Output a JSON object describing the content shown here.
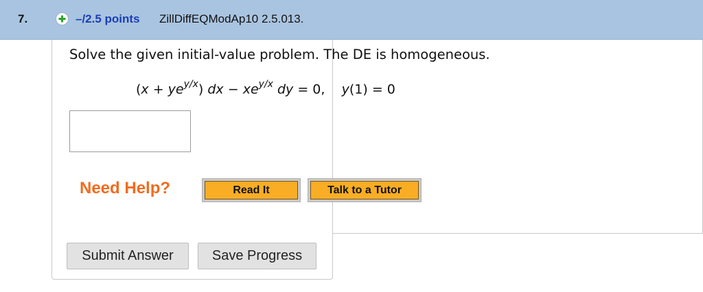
{
  "question": {
    "number": "7.",
    "points": "–/2.5 points",
    "source": "ZillDiffEQModAp10 2.5.013."
  },
  "problem": {
    "prompt": "Solve the given initial-value problem. The DE is homogeneous."
  },
  "equation": {
    "open": "(",
    "x1": "x",
    "plus": " + ",
    "y1": "y",
    "e1": "e",
    "exp1": "y/x",
    "close": ") ",
    "dx": "dx",
    "minus": " − ",
    "x2": "x",
    "e2": "e",
    "exp2": "y/x",
    "dy": " dy",
    "eq": " = 0,",
    "spacer": "    ",
    "ic_y": "y",
    "ic_rest": "(1) = 0"
  },
  "answer": {
    "value": ""
  },
  "help": {
    "label": "Need Help?",
    "read_it": "Read It",
    "talk_tutor": "Talk to a Tutor"
  },
  "actions": {
    "submit": "Submit Answer",
    "save": "Save Progress"
  },
  "colors": {
    "header_bg": "#a9c4e0",
    "points_text": "#1a3fb4",
    "need_help": "#f26b1d",
    "help_button": "#f8ad25"
  },
  "icons": {
    "expand": "plus-circle-icon"
  }
}
